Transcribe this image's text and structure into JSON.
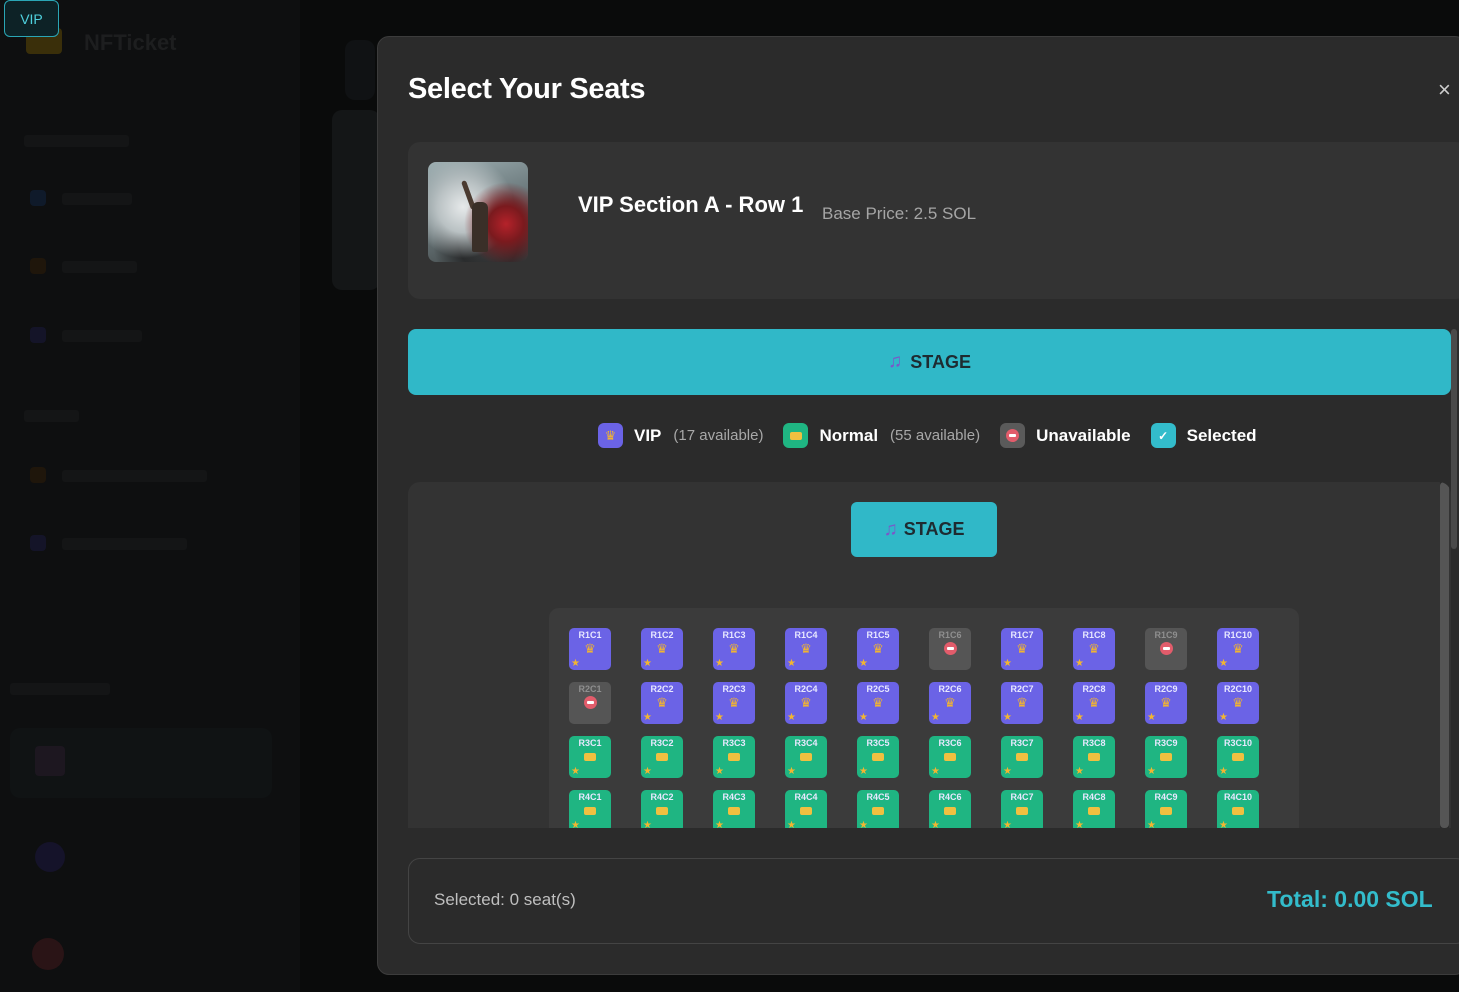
{
  "app": {
    "brand": "NFTicket",
    "vip_chip": "VIP"
  },
  "modal": {
    "title": "Select Your Seats",
    "close_label": "×"
  },
  "section": {
    "name": "VIP Section A - Row 1",
    "base_price": "Base Price: 2.5 SOL"
  },
  "stage": {
    "banner_label": "STAGE",
    "button_label": "STAGE",
    "icon": "music-note-icon"
  },
  "legend": {
    "vip_label": "VIP",
    "vip_count": "(17 available)",
    "normal_label": "Normal",
    "normal_count": "(55 available)",
    "unavailable_label": "Unavailable",
    "selected_label": "Selected",
    "selected_check": "✓"
  },
  "colors": {
    "accent": "#30b8c8",
    "vip": "#6b63e6",
    "normal": "#1fb582",
    "unavailable": "#555555",
    "modal_bg": "#2b2b2b"
  },
  "seats": {
    "rows": [
      [
        {
          "code": "R1C1",
          "type": "vip"
        },
        {
          "code": "R1C2",
          "type": "vip"
        },
        {
          "code": "R1C3",
          "type": "vip"
        },
        {
          "code": "R1C4",
          "type": "vip"
        },
        {
          "code": "R1C5",
          "type": "vip"
        },
        {
          "code": "R1C6",
          "type": "unavailable"
        },
        {
          "code": "R1C7",
          "type": "vip"
        },
        {
          "code": "R1C8",
          "type": "vip"
        },
        {
          "code": "R1C9",
          "type": "unavailable"
        },
        {
          "code": "R1C10",
          "type": "vip"
        }
      ],
      [
        {
          "code": "R2C1",
          "type": "unavailable"
        },
        {
          "code": "R2C2",
          "type": "vip"
        },
        {
          "code": "R2C3",
          "type": "vip"
        },
        {
          "code": "R2C4",
          "type": "vip"
        },
        {
          "code": "R2C5",
          "type": "vip"
        },
        {
          "code": "R2C6",
          "type": "vip"
        },
        {
          "code": "R2C7",
          "type": "vip"
        },
        {
          "code": "R2C8",
          "type": "vip"
        },
        {
          "code": "R2C9",
          "type": "vip"
        },
        {
          "code": "R2C10",
          "type": "vip"
        }
      ],
      [
        {
          "code": "R3C1",
          "type": "normal"
        },
        {
          "code": "R3C2",
          "type": "normal"
        },
        {
          "code": "R3C3",
          "type": "normal"
        },
        {
          "code": "R3C4",
          "type": "normal"
        },
        {
          "code": "R3C5",
          "type": "normal"
        },
        {
          "code": "R3C6",
          "type": "normal"
        },
        {
          "code": "R3C7",
          "type": "normal"
        },
        {
          "code": "R3C8",
          "type": "normal"
        },
        {
          "code": "R3C9",
          "type": "normal"
        },
        {
          "code": "R3C10",
          "type": "normal"
        }
      ],
      [
        {
          "code": "R4C1",
          "type": "normal"
        },
        {
          "code": "R4C2",
          "type": "normal"
        },
        {
          "code": "R4C3",
          "type": "normal"
        },
        {
          "code": "R4C4",
          "type": "normal"
        },
        {
          "code": "R4C5",
          "type": "normal"
        },
        {
          "code": "R4C6",
          "type": "normal"
        },
        {
          "code": "R4C7",
          "type": "normal"
        },
        {
          "code": "R4C8",
          "type": "normal"
        },
        {
          "code": "R4C9",
          "type": "normal"
        },
        {
          "code": "R4C10",
          "type": "normal"
        }
      ]
    ]
  },
  "summary": {
    "selected_text": "Selected: 0 seat(s)",
    "total_text": "Total: 0.00 SOL"
  }
}
